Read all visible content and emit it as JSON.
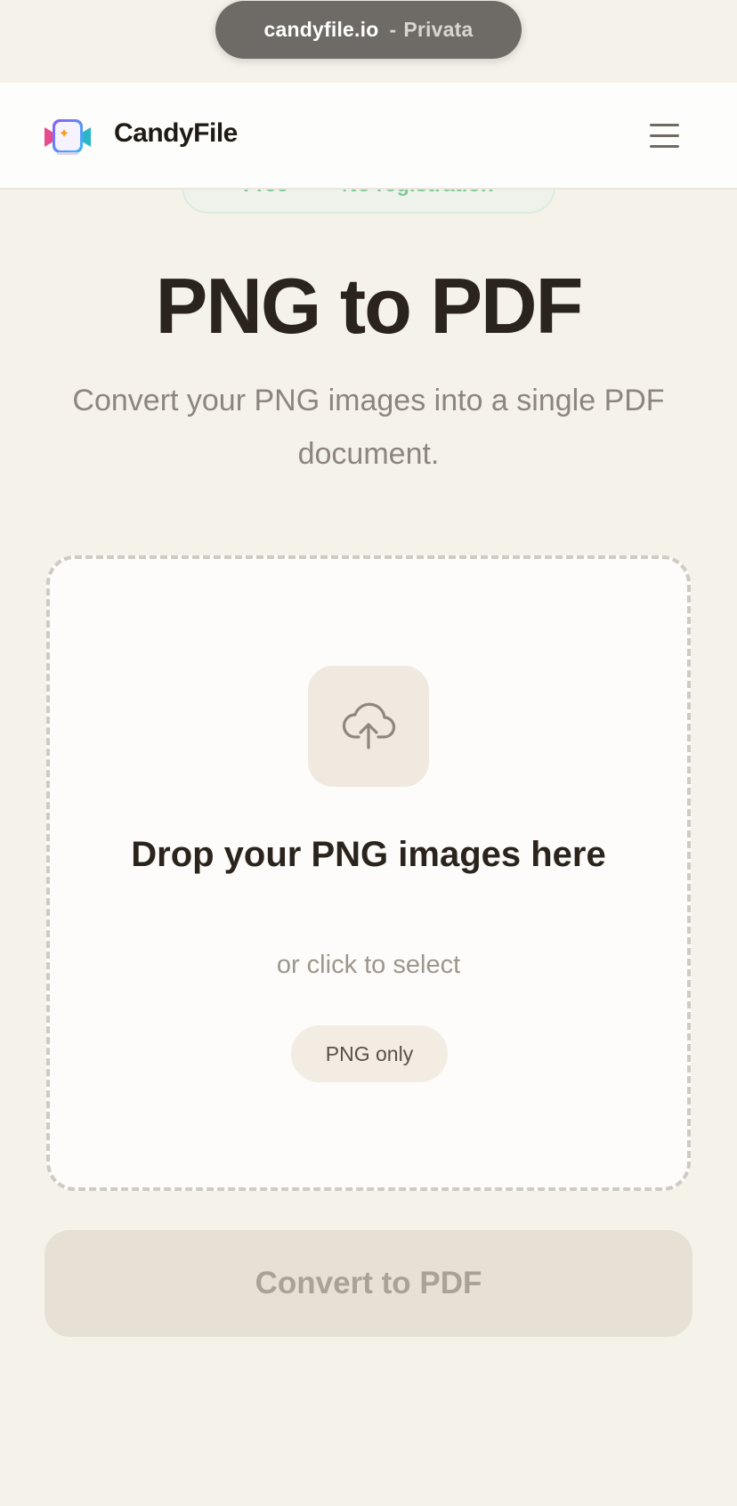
{
  "browser": {
    "domain": "candyfile.io",
    "separator": "-",
    "mode": "Privata"
  },
  "badge": {
    "left": "Free",
    "right": "No registration"
  },
  "header": {
    "brand": "CandyFile",
    "logo_icon": "candyfile-logo-icon",
    "menu_icon": "hamburger-menu-icon"
  },
  "hero": {
    "title": "PNG to PDF",
    "subtitle": "Convert your PNG images into a single PDF document."
  },
  "dropzone": {
    "icon": "cloud-upload-icon",
    "title": "Drop your PNG images here",
    "hint": "or click to select",
    "format_chip": "PNG only"
  },
  "actions": {
    "convert_label": "Convert to PDF",
    "convert_disabled": true
  },
  "colors": {
    "page_bg": "#f5f2ea",
    "text_primary": "#2b241d",
    "text_muted": "#8c867d",
    "badge_green": "#6cc48a",
    "button_disabled_bg": "#e7e0d4"
  }
}
